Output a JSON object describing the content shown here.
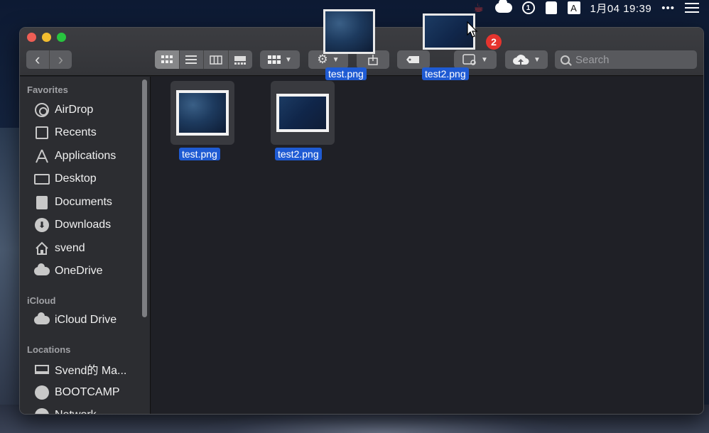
{
  "menubar": {
    "input_indicator": "A",
    "clock": "1月04 19:39",
    "more": "•••"
  },
  "toolbar": {
    "back_glyph": "‹",
    "forward_glyph": "›",
    "search_placeholder": "Search"
  },
  "sidebar": {
    "favorites_title": "Favorites",
    "favorites": [
      {
        "label": "AirDrop",
        "icon": "airdrop-icon"
      },
      {
        "label": "Recents",
        "icon": "recents-icon"
      },
      {
        "label": "Applications",
        "icon": "applications-icon"
      },
      {
        "label": "Desktop",
        "icon": "desktop-icon"
      },
      {
        "label": "Documents",
        "icon": "documents-icon"
      },
      {
        "label": "Downloads",
        "icon": "downloads-icon"
      },
      {
        "label": "svend",
        "icon": "home-icon"
      },
      {
        "label": "OneDrive",
        "icon": "cloud-icon"
      }
    ],
    "icloud_title": "iCloud",
    "icloud": [
      {
        "label": "iCloud Drive",
        "icon": "icloud-icon"
      }
    ],
    "locations_title": "Locations",
    "locations": [
      {
        "label": "Svend的 Ma...",
        "icon": "laptop-icon"
      },
      {
        "label": "BOOTCAMP",
        "icon": "disk-icon"
      },
      {
        "label": "Network",
        "icon": "network-icon"
      }
    ]
  },
  "files": [
    {
      "name": "test.png"
    },
    {
      "name": "test2.png"
    }
  ],
  "drag": {
    "items": [
      {
        "name": "test.png"
      },
      {
        "name": "test2.png"
      }
    ],
    "count": "2"
  },
  "colors": {
    "selection": "#1f5bd3",
    "badge": "#e5342e"
  }
}
